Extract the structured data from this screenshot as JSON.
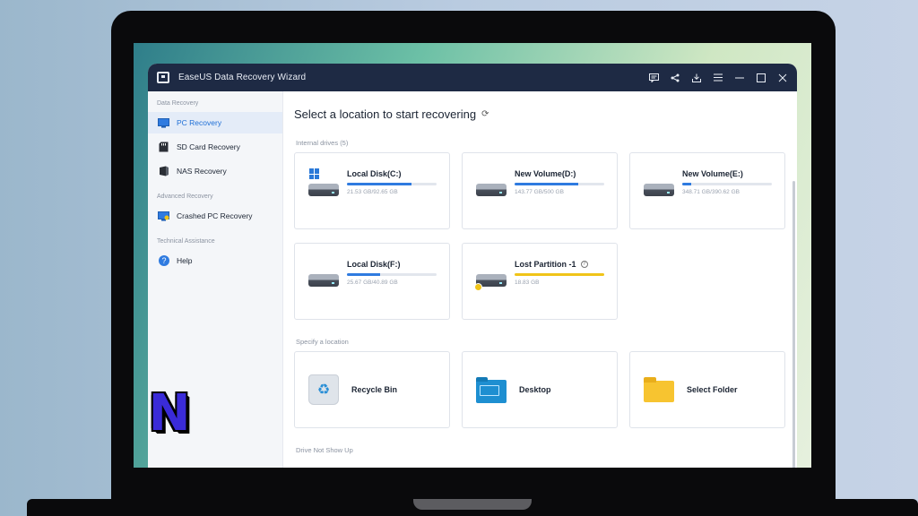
{
  "window": {
    "title": "EaseUS Data Recovery Wizard"
  },
  "titlebar_icons": [
    "feedback-icon",
    "share-icon",
    "download-icon",
    "menu-icon",
    "minimize-icon",
    "maximize-icon",
    "close-icon"
  ],
  "sidebar": {
    "sections": [
      {
        "label": "Data Recovery"
      },
      {
        "label": "Advanced Recovery"
      },
      {
        "label": "Technical Assistance"
      }
    ],
    "items": [
      {
        "label": "PC Recovery",
        "active": true,
        "icon": "monitor-icon"
      },
      {
        "label": "SD Card Recovery",
        "icon": "sd-card-icon"
      },
      {
        "label": "NAS Recovery",
        "icon": "nas-icon"
      },
      {
        "label": "Crashed PC Recovery",
        "icon": "crashed-pc-icon"
      },
      {
        "label": "Help",
        "icon": "help-icon"
      }
    ]
  },
  "main": {
    "heading": "Select a location to start recovering",
    "internal_label": "Internal drives (5)",
    "drives": [
      {
        "name": "Local Disk(C:)",
        "size": "21.53 GB/92.65 GB",
        "fill": 0.72,
        "system": true
      },
      {
        "name": "New Volume(D:)",
        "size": "143.77 GB/500 GB",
        "fill": 0.71
      },
      {
        "name": "New Volume(E:)",
        "size": "348.71 GB/390.62 GB",
        "fill": 0.1
      },
      {
        "name": "Local Disk(F:)",
        "size": "25.67 GB/40.89 GB",
        "fill": 0.37
      },
      {
        "name": "Lost Partition -1",
        "size": "18.83 GB",
        "fill": 1.0,
        "lost": true
      }
    ],
    "specify_label": "Specify a location",
    "locations": [
      {
        "name": "Recycle Bin",
        "icon": "recycle-bin-icon"
      },
      {
        "name": "Desktop",
        "icon": "desktop-folder-icon"
      },
      {
        "name": "Select Folder",
        "icon": "folder-icon"
      }
    ],
    "drive_not_show_label": "Drive Not Show Up"
  },
  "badge": {
    "letter": "N"
  },
  "colors": {
    "titlebar": "#1e2a44",
    "accent": "#2f7be0",
    "warning": "#f0c419"
  }
}
